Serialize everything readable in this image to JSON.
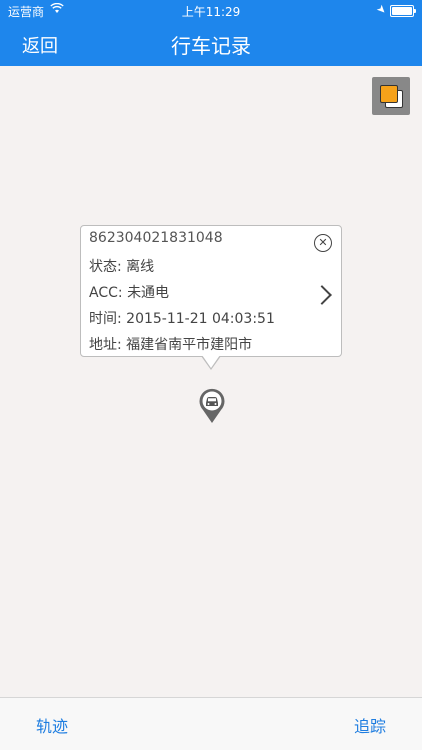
{
  "status_bar": {
    "carrier": "运营商",
    "time": "上午11:29",
    "wifi_icon": "wifi-icon",
    "location_icon": "location-arrow-icon",
    "battery_icon": "battery-icon"
  },
  "nav": {
    "back_label": "返回",
    "title": "行车记录"
  },
  "map": {
    "layer_icon": "layers-icon",
    "marker_icon": "car-pin-icon"
  },
  "popup": {
    "device_id": "862304021831048",
    "status_label": "状态:",
    "status_value": "离线",
    "acc_label": "ACC:",
    "acc_value": "未通电",
    "time_label": "时间:",
    "time_value": "2015-11-21 04:03:51",
    "address_label": "地址:",
    "address_value": "福建省南平市建阳市",
    "close_icon": "close-circle-icon",
    "detail_icon": "chevron-right-icon"
  },
  "bottom_bar": {
    "left_label": "轨迹",
    "right_label": "追踪"
  },
  "colors": {
    "header_blue": "#1e86ec",
    "map_bg": "#f5f2f1",
    "tab_blue": "#1e7de0",
    "layer_orange": "#f6a21a"
  }
}
